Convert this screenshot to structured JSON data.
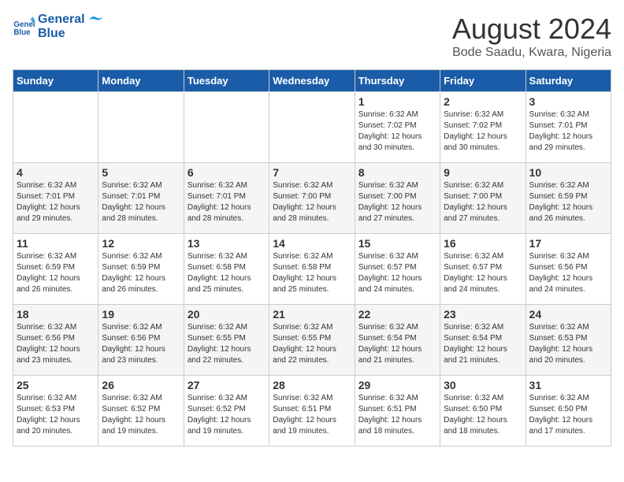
{
  "header": {
    "logo_general": "General",
    "logo_blue": "Blue",
    "month_year": "August 2024",
    "location": "Bode Saadu, Kwara, Nigeria"
  },
  "days_of_week": [
    "Sunday",
    "Monday",
    "Tuesday",
    "Wednesday",
    "Thursday",
    "Friday",
    "Saturday"
  ],
  "weeks": [
    [
      {
        "day": "",
        "sunrise": "",
        "sunset": "",
        "daylight": ""
      },
      {
        "day": "",
        "sunrise": "",
        "sunset": "",
        "daylight": ""
      },
      {
        "day": "",
        "sunrise": "",
        "sunset": "",
        "daylight": ""
      },
      {
        "day": "",
        "sunrise": "",
        "sunset": "",
        "daylight": ""
      },
      {
        "day": "1",
        "sunrise": "6:32 AM",
        "sunset": "7:02 PM",
        "daylight": "12 hours and 30 minutes."
      },
      {
        "day": "2",
        "sunrise": "6:32 AM",
        "sunset": "7:02 PM",
        "daylight": "12 hours and 30 minutes."
      },
      {
        "day": "3",
        "sunrise": "6:32 AM",
        "sunset": "7:01 PM",
        "daylight": "12 hours and 29 minutes."
      }
    ],
    [
      {
        "day": "4",
        "sunrise": "6:32 AM",
        "sunset": "7:01 PM",
        "daylight": "12 hours and 29 minutes."
      },
      {
        "day": "5",
        "sunrise": "6:32 AM",
        "sunset": "7:01 PM",
        "daylight": "12 hours and 28 minutes."
      },
      {
        "day": "6",
        "sunrise": "6:32 AM",
        "sunset": "7:01 PM",
        "daylight": "12 hours and 28 minutes."
      },
      {
        "day": "7",
        "sunrise": "6:32 AM",
        "sunset": "7:00 PM",
        "daylight": "12 hours and 28 minutes."
      },
      {
        "day": "8",
        "sunrise": "6:32 AM",
        "sunset": "7:00 PM",
        "daylight": "12 hours and 27 minutes."
      },
      {
        "day": "9",
        "sunrise": "6:32 AM",
        "sunset": "7:00 PM",
        "daylight": "12 hours and 27 minutes."
      },
      {
        "day": "10",
        "sunrise": "6:32 AM",
        "sunset": "6:59 PM",
        "daylight": "12 hours and 26 minutes."
      }
    ],
    [
      {
        "day": "11",
        "sunrise": "6:32 AM",
        "sunset": "6:59 PM",
        "daylight": "12 hours and 26 minutes."
      },
      {
        "day": "12",
        "sunrise": "6:32 AM",
        "sunset": "6:59 PM",
        "daylight": "12 hours and 26 minutes."
      },
      {
        "day": "13",
        "sunrise": "6:32 AM",
        "sunset": "6:58 PM",
        "daylight": "12 hours and 25 minutes."
      },
      {
        "day": "14",
        "sunrise": "6:32 AM",
        "sunset": "6:58 PM",
        "daylight": "12 hours and 25 minutes."
      },
      {
        "day": "15",
        "sunrise": "6:32 AM",
        "sunset": "6:57 PM",
        "daylight": "12 hours and 24 minutes."
      },
      {
        "day": "16",
        "sunrise": "6:32 AM",
        "sunset": "6:57 PM",
        "daylight": "12 hours and 24 minutes."
      },
      {
        "day": "17",
        "sunrise": "6:32 AM",
        "sunset": "6:56 PM",
        "daylight": "12 hours and 24 minutes."
      }
    ],
    [
      {
        "day": "18",
        "sunrise": "6:32 AM",
        "sunset": "6:56 PM",
        "daylight": "12 hours and 23 minutes."
      },
      {
        "day": "19",
        "sunrise": "6:32 AM",
        "sunset": "6:56 PM",
        "daylight": "12 hours and 23 minutes."
      },
      {
        "day": "20",
        "sunrise": "6:32 AM",
        "sunset": "6:55 PM",
        "daylight": "12 hours and 22 minutes."
      },
      {
        "day": "21",
        "sunrise": "6:32 AM",
        "sunset": "6:55 PM",
        "daylight": "12 hours and 22 minutes."
      },
      {
        "day": "22",
        "sunrise": "6:32 AM",
        "sunset": "6:54 PM",
        "daylight": "12 hours and 21 minutes."
      },
      {
        "day": "23",
        "sunrise": "6:32 AM",
        "sunset": "6:54 PM",
        "daylight": "12 hours and 21 minutes."
      },
      {
        "day": "24",
        "sunrise": "6:32 AM",
        "sunset": "6:53 PM",
        "daylight": "12 hours and 20 minutes."
      }
    ],
    [
      {
        "day": "25",
        "sunrise": "6:32 AM",
        "sunset": "6:53 PM",
        "daylight": "12 hours and 20 minutes."
      },
      {
        "day": "26",
        "sunrise": "6:32 AM",
        "sunset": "6:52 PM",
        "daylight": "12 hours and 19 minutes."
      },
      {
        "day": "27",
        "sunrise": "6:32 AM",
        "sunset": "6:52 PM",
        "daylight": "12 hours and 19 minutes."
      },
      {
        "day": "28",
        "sunrise": "6:32 AM",
        "sunset": "6:51 PM",
        "daylight": "12 hours and 19 minutes."
      },
      {
        "day": "29",
        "sunrise": "6:32 AM",
        "sunset": "6:51 PM",
        "daylight": "12 hours and 18 minutes."
      },
      {
        "day": "30",
        "sunrise": "6:32 AM",
        "sunset": "6:50 PM",
        "daylight": "12 hours and 18 minutes."
      },
      {
        "day": "31",
        "sunrise": "6:32 AM",
        "sunset": "6:50 PM",
        "daylight": "12 hours and 17 minutes."
      }
    ]
  ],
  "labels": {
    "sunrise_prefix": "Sunrise: ",
    "sunset_prefix": "Sunset: ",
    "daylight_prefix": "Daylight: "
  }
}
